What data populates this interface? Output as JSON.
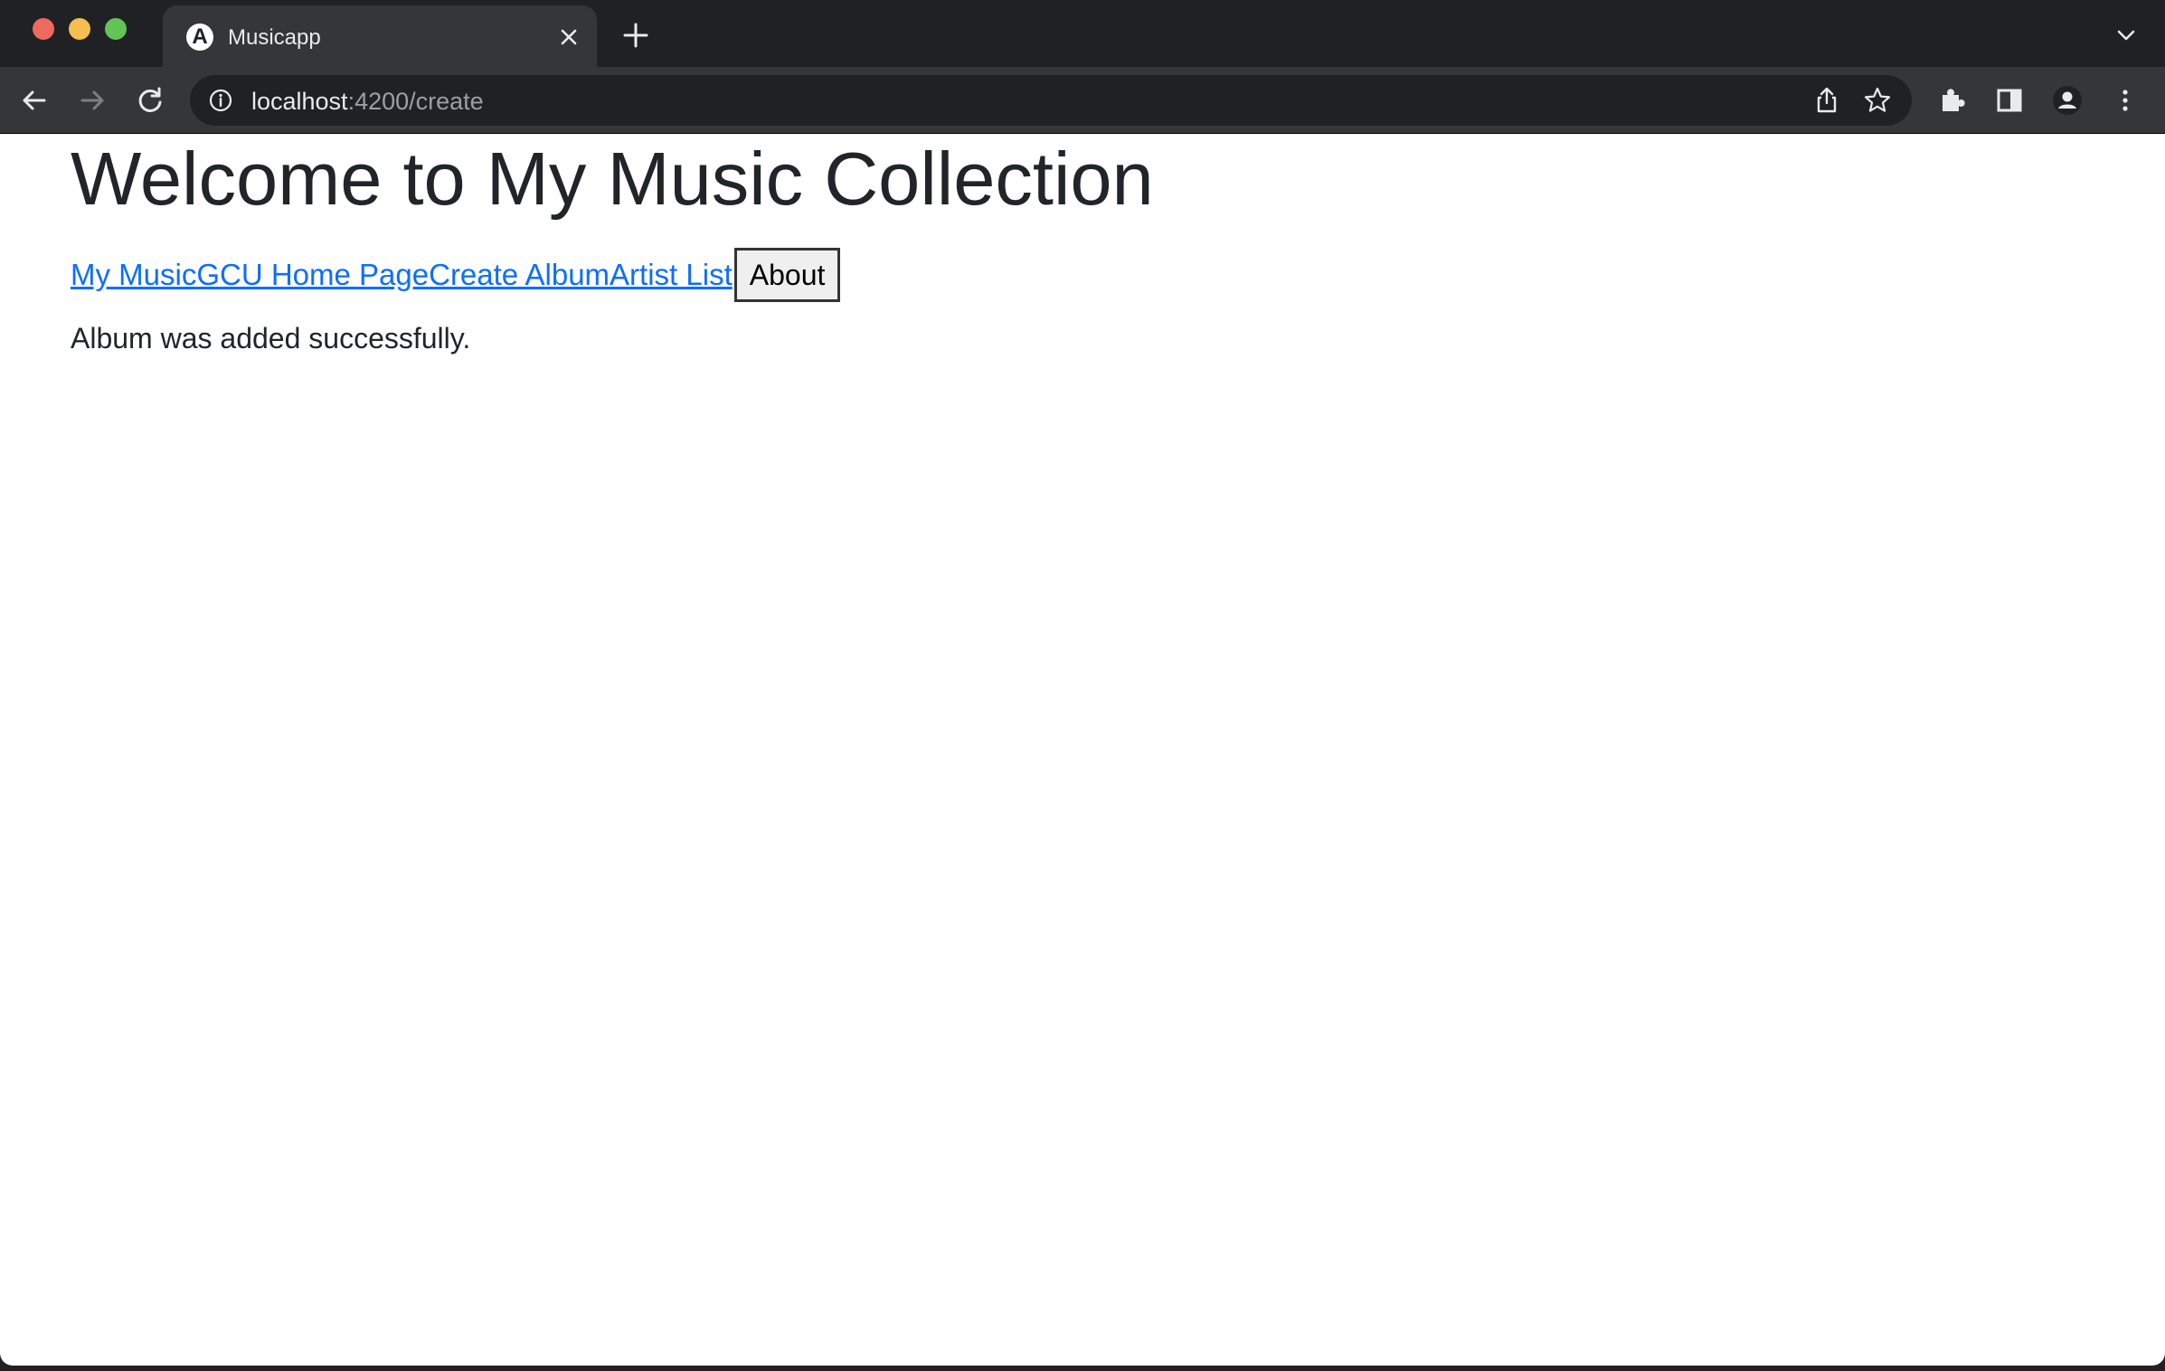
{
  "browser": {
    "tab": {
      "title": "Musicapp",
      "favicon_letter": "A"
    },
    "address": {
      "host": "localhost",
      "path": ":4200/create"
    }
  },
  "page": {
    "title": "Welcome to My Music Collection",
    "nav": {
      "links": [
        "My Music",
        "GCU Home Page",
        "Create Album",
        "Artist List"
      ],
      "about_button": "About"
    },
    "status_message": "Album was added successfully."
  }
}
